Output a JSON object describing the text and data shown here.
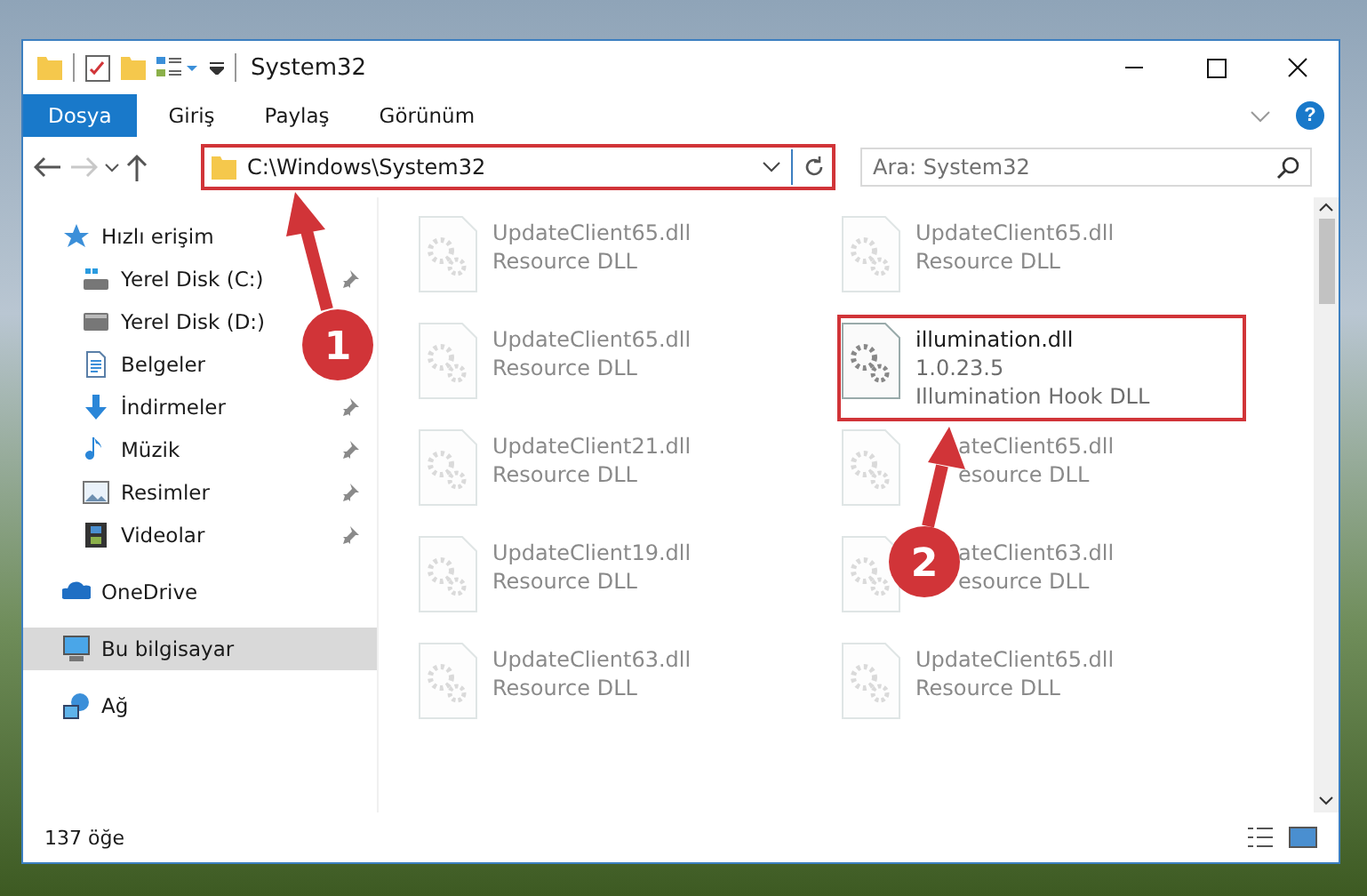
{
  "window": {
    "title": "System32"
  },
  "ribbon": {
    "tabs": [
      {
        "label": "Dosya",
        "kind": "file"
      },
      {
        "label": "Giriş",
        "kind": "tab"
      },
      {
        "label": "Paylaş",
        "kind": "tab"
      },
      {
        "label": "Görünüm",
        "kind": "tab"
      }
    ],
    "help": "?"
  },
  "navigation": {
    "forward_disabled": true
  },
  "address_bar": {
    "path": "C:\\Windows\\System32",
    "highlighted": true
  },
  "search": {
    "placeholder": "Ara: System32"
  },
  "sidebar": {
    "items": [
      {
        "label": "Hızlı erişim",
        "kind": "star",
        "pinned": false,
        "selected": false,
        "children": [
          {
            "label": "Yerel Disk (C:)",
            "kind": "drive-win",
            "pinned": true,
            "selected": false
          },
          {
            "label": "Yerel Disk (D:)",
            "kind": "drive",
            "pinned": false,
            "selected": false
          },
          {
            "label": "Belgeler",
            "kind": "doc",
            "pinned": false,
            "selected": false
          },
          {
            "label": "İndirmeler",
            "kind": "download",
            "pinned": true,
            "selected": false
          },
          {
            "label": "Müzik",
            "kind": "music",
            "pinned": true,
            "selected": false
          },
          {
            "label": "Resimler",
            "kind": "picture",
            "pinned": true,
            "selected": false
          },
          {
            "label": "Videolar",
            "kind": "video",
            "pinned": true,
            "selected": false
          }
        ]
      },
      {
        "label": "OneDrive",
        "kind": "cloud",
        "pinned": false,
        "selected": false
      },
      {
        "label": "Bu bilgisayar",
        "kind": "computer",
        "pinned": false,
        "selected": true
      },
      {
        "label": "Ağ",
        "kind": "network",
        "pinned": false,
        "selected": false
      }
    ]
  },
  "files": [
    {
      "name": "UpdateClient65.dll",
      "details": [
        "Resource DLL"
      ],
      "faded": true,
      "highlighted": false,
      "covered": false
    },
    {
      "name": "UpdateClient65.dll",
      "details": [
        "Resource DLL"
      ],
      "faded": true,
      "highlighted": false,
      "covered": false
    },
    {
      "name": "UpdateClient65.dll",
      "details": [
        "Resource DLL"
      ],
      "faded": true,
      "highlighted": false,
      "covered": false
    },
    {
      "name": "illumination.dll",
      "details": [
        "1.0.23.5",
        "Illumination Hook DLL"
      ],
      "faded": false,
      "highlighted": true,
      "covered": false
    },
    {
      "name": "UpdateClient21.dll",
      "details": [
        "Resource DLL"
      ],
      "faded": true,
      "highlighted": false,
      "covered": false
    },
    {
      "name": "ateClient65.dll",
      "details": [
        "esource DLL"
      ],
      "faded": true,
      "highlighted": false,
      "covered": true
    },
    {
      "name": "UpdateClient19.dll",
      "details": [
        "Resource DLL"
      ],
      "faded": true,
      "highlighted": false,
      "covered": false
    },
    {
      "name": "ateClient63.dll",
      "details": [
        "esource DLL"
      ],
      "faded": true,
      "highlighted": false,
      "covered": true
    },
    {
      "name": "UpdateClient63.dll",
      "details": [
        "Resource DLL"
      ],
      "faded": true,
      "highlighted": false,
      "covered": false
    },
    {
      "name": "UpdateClient65.dll",
      "details": [
        "Resource DLL"
      ],
      "faded": true,
      "highlighted": false,
      "covered": false
    }
  ],
  "status_bar": {
    "item_count": "137 öğe"
  },
  "annotations": [
    {
      "label": "1"
    },
    {
      "label": "2"
    }
  ]
}
